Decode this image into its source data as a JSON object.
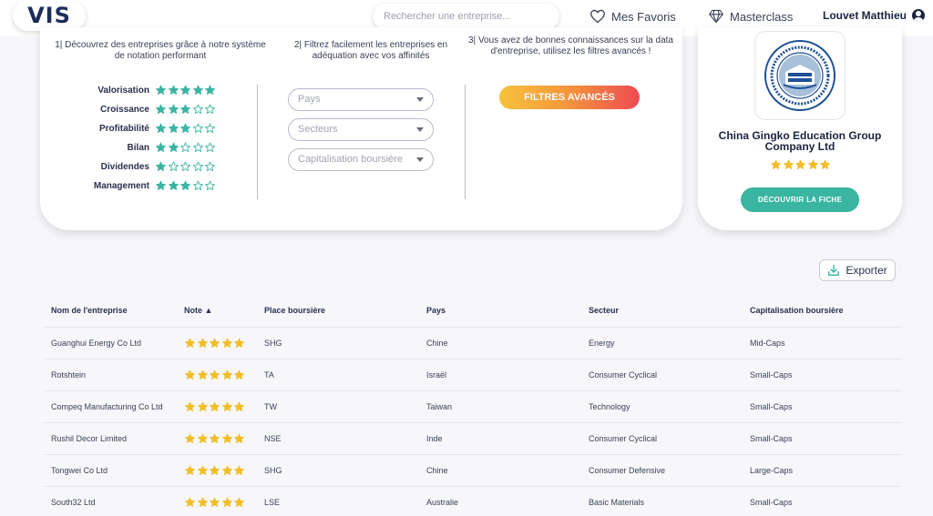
{
  "header": {
    "logo": "VIS",
    "search_placeholder": "Rechercher une entreprise...",
    "favorites": "Mes Favoris",
    "masterclass": "Masterclass",
    "user": "Louvet Matthieu"
  },
  "filters": {
    "step1": "1| Découvrez des entreprises grâce à notre système de notation performant",
    "step2": "2| Filtrez facilement les entreprises en adéquation avec vos affinités",
    "step3": "3| Vous avez de bonnes connaissances sur la data d'entreprise, utilisez les filtres avancés !",
    "ratings": [
      {
        "label": "Valorisation",
        "stars": 5
      },
      {
        "label": "Croissance",
        "stars": 3
      },
      {
        "label": "Profitabilité",
        "stars": 3
      },
      {
        "label": "Bilan",
        "stars": 2
      },
      {
        "label": "Dividendes",
        "stars": 1
      },
      {
        "label": "Management",
        "stars": 3
      }
    ],
    "selects": [
      "Pays",
      "Secteurs",
      "Capitalisation boursière"
    ],
    "advanced_button": "FILTRES AVANCÉS"
  },
  "featured": {
    "name": "China Gingko Education Group Company Ltd",
    "stars": 5,
    "button": "DÉCOUVRIR LA FICHE"
  },
  "export_label": "Exporter",
  "table": {
    "headers": [
      "Nom de l'entreprise",
      "Note ▲",
      "Place boursière",
      "Pays",
      "Secteur",
      "Capitalisation boursière"
    ],
    "rows": [
      {
        "name": "Guanghui Energy Co Ltd",
        "stars": 5,
        "exchange": "SHG",
        "country": "Chine",
        "sector": "Energy",
        "cap": "Mid-Caps"
      },
      {
        "name": "Rotshtein",
        "stars": 5,
        "exchange": "TA",
        "country": "Israël",
        "sector": "Consumer Cyclical",
        "cap": "Small-Caps"
      },
      {
        "name": "Compeq Manufacturing Co Ltd",
        "stars": 5,
        "exchange": "TW",
        "country": "Taiwan",
        "sector": "Technology",
        "cap": "Small-Caps"
      },
      {
        "name": "Rushil Decor Limited",
        "stars": 5,
        "exchange": "NSE",
        "country": "Inde",
        "sector": "Consumer Cyclical",
        "cap": "Small-Caps"
      },
      {
        "name": "Tongwei Co Ltd",
        "stars": 5,
        "exchange": "SHG",
        "country": "Chine",
        "sector": "Consumer Defensive",
        "cap": "Large-Caps"
      },
      {
        "name": "South32 Ltd",
        "stars": 5,
        "exchange": "LSE",
        "country": "Australie",
        "sector": "Basic Materials",
        "cap": "Small-Caps"
      }
    ]
  },
  "colors": {
    "teal_star": "#3ab5a2",
    "gold_star": "#f2bd2a",
    "accent_gradient_start": "#f6c23d",
    "accent_gradient_end": "#ee4b54"
  }
}
